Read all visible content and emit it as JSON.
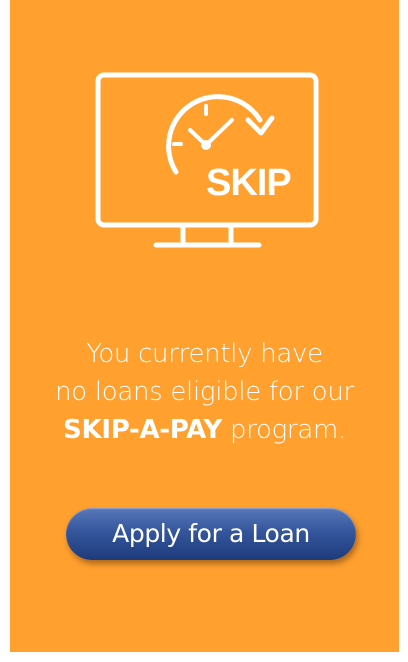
{
  "illustration": {
    "icon_text": "SKIP"
  },
  "message": {
    "line1": "You currently have",
    "line2": "no loans eligible for our",
    "program_name": "SKIP-A-PAY",
    "line3_suffix": " program."
  },
  "apply_button": {
    "label": "Apply for a Loan"
  },
  "colors": {
    "background": "#ffa02f",
    "button": "#35569c",
    "text": "#ffffff"
  }
}
